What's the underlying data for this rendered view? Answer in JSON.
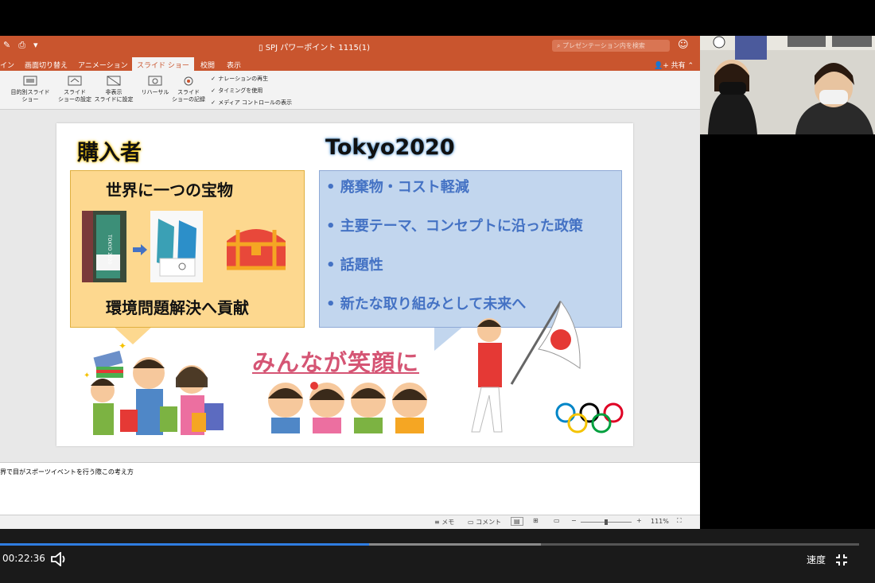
{
  "titlebar": {
    "document_title": "SPJ パワーポイント 1115(1)",
    "search_placeholder": "プレゼンテーション内を検索"
  },
  "tabs": [
    {
      "label": "イン"
    },
    {
      "label": "画面切り替え"
    },
    {
      "label": "アニメーション"
    },
    {
      "label": "スライド ショー"
    },
    {
      "label": "校閲"
    },
    {
      "label": "表示"
    }
  ],
  "share_label": "共有",
  "ribbon": {
    "custom_show": "目的別スライド\nショー",
    "setup_show": "スライド\nショーの設定",
    "hide_slide": "非表示\nスライドに設定",
    "rehearse": "リハーサル",
    "record_show": "スライド\nショーの記録",
    "checks": [
      "ナレーションの再生",
      "タイミングを使用",
      "メディア コントロールの表示"
    ]
  },
  "slide": {
    "buyer_heading": "購入者",
    "tokyo_heading": "Tokyo2020",
    "buyer_title": "世界に一つの宝物",
    "buyer_bottom": "環境問題解決へ貢献",
    "bullets": [
      "廃棄物・コスト軽減",
      "主要テーマ、コンセプトに沿った政策",
      "話題性",
      "新たな取り組みとして未来へ"
    ],
    "center_text": "みんなが笑顔に",
    "banner_text": "TOKYO 2020"
  },
  "notes_text": "界で目がスポーツイベントを行う際この考え方",
  "statusbar": {
    "memo": "メモ",
    "comment": "コメント",
    "zoom": "111%"
  },
  "video": {
    "time": "00:22:36",
    "speed_label": "速度",
    "progress": 0.43,
    "buffered": 0.63
  },
  "colors": {
    "accent": "#c9552e",
    "buyer_box": "#fdd88f",
    "tokyo_box": "#c2d6ee",
    "bullet_text": "#4472c4",
    "center_text": "#d55574"
  }
}
